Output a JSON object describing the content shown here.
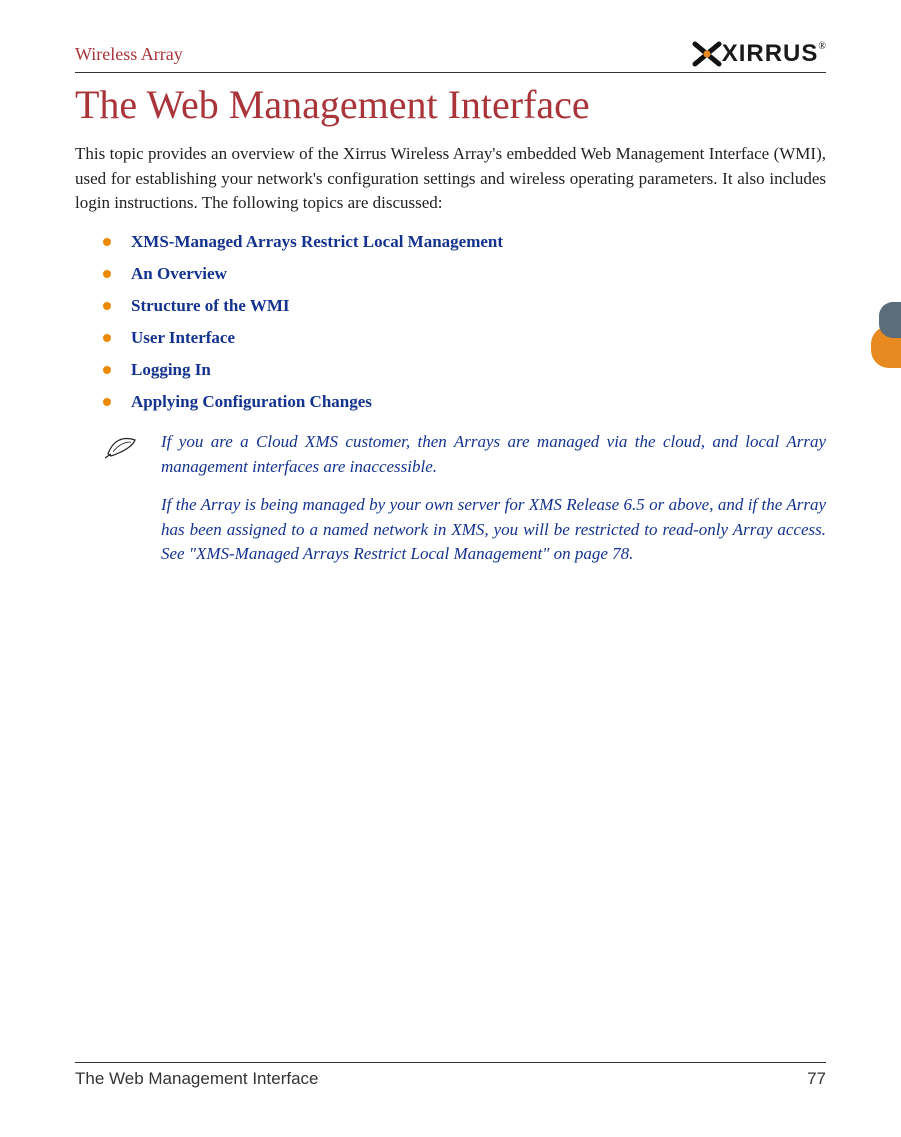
{
  "header": {
    "left": "Wireless Array",
    "logo_text": "XIRRUS",
    "logo_mark": "®"
  },
  "title": "The Web Management Interface",
  "intro": "This topic provides an overview of the Xirrus Wireless Array's embedded Web Management Interface (WMI), used for establishing your network's configuration settings and wireless operating parameters. It also includes login instructions. The following topics are discussed:",
  "topics": [
    "XMS-Managed Arrays Restrict Local Management",
    "An Overview",
    "Structure of the WMI",
    "User Interface",
    "Logging In",
    "Applying Configuration Changes"
  ],
  "note": {
    "para1": "If you are a Cloud XMS customer, then Arrays are managed via the cloud, and local Array management interfaces are inaccessible.",
    "para2": "If the Array is being managed by your own server for XMS Release 6.5 or above, and if the Array has been assigned to a named network in XMS, you will be restricted to read-only Array access. See \"XMS-Managed Arrays Restrict Local Management\" on page 78."
  },
  "footer": {
    "left": "The Web Management Interface",
    "right": "77"
  }
}
